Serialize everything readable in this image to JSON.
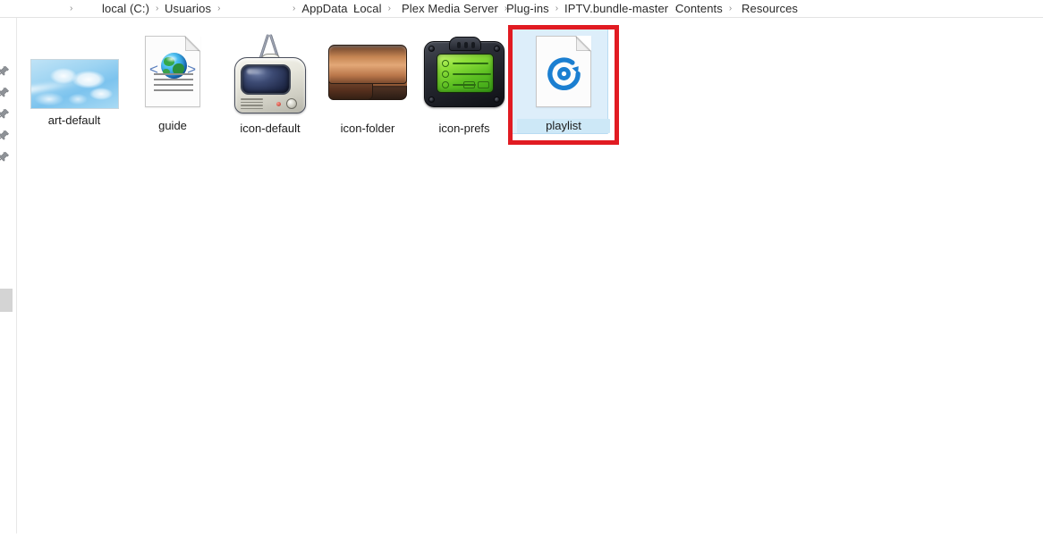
{
  "window": {
    "background_color": "#ffffff",
    "content_area_label": "file-list"
  },
  "addressbar": {
    "name": "breadcrumb-address-bar",
    "separator": "›",
    "crumbs": [
      {
        "label": "local (C:)",
        "name": "crumb-local-c"
      },
      {
        "label": "Usuarios",
        "name": "crumb-usuarios"
      },
      {
        "label": "AppData",
        "name": "crumb-appdata"
      },
      {
        "label": "Local",
        "name": "crumb-local"
      },
      {
        "label": "Plex Media Server",
        "name": "crumb-plex-media-server"
      },
      {
        "label": "Plug-ins",
        "name": "crumb-plug-ins"
      },
      {
        "label": "IPTV.bundle-master",
        "name": "crumb-iptv-bundle-master"
      },
      {
        "label": "Contents",
        "name": "crumb-contents"
      },
      {
        "label": "Resources",
        "name": "crumb-resources"
      }
    ]
  },
  "navpane": {
    "name": "navigation-pane-clipped",
    "pin_count": 5,
    "partial_glyph": ")",
    "scrollbar_visible": true
  },
  "files": [
    {
      "name": "art-default",
      "label": "art-default",
      "icon": "sky-image-thumbnail",
      "selected": false
    },
    {
      "name": "guide",
      "label": "guide",
      "icon": "html-document-globe-icon",
      "selected": false
    },
    {
      "name": "icon-default",
      "label": "icon-default",
      "icon": "retro-television-icon",
      "selected": false
    },
    {
      "name": "icon-folder",
      "label": "icon-folder",
      "icon": "copper-folder-icon",
      "selected": false
    },
    {
      "name": "icon-prefs",
      "label": "icon-prefs",
      "icon": "green-lcd-device-icon",
      "selected": false
    },
    {
      "name": "playlist",
      "label": "playlist",
      "icon": "vlc-disc-document-icon",
      "selected": true
    }
  ],
  "annotation": {
    "name": "red-highlight-rectangle",
    "target": "playlist",
    "color": "#e11b22",
    "border_width_px": 5
  },
  "colors": {
    "selection_fill": "#ddeefa",
    "selection_border": "#b9dcf2",
    "annotation_red": "#e11b22",
    "disc_blue": "#1b7fd1",
    "text": "#1b1b1b",
    "separator": "#8a8a8a"
  }
}
